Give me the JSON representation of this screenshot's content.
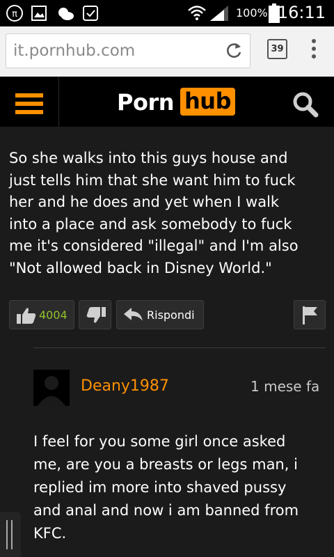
{
  "status_bar": {
    "battery_percent": "100%",
    "time": "16:11",
    "icons": [
      "pi-app-icon",
      "gallery-icon",
      "weather-icon",
      "download-done-icon",
      "wifi-icon",
      "signal-icon",
      "battery-icon"
    ]
  },
  "browser": {
    "url": "it.pornhub.com",
    "tab_count": "39",
    "icons": [
      "reload-icon",
      "overflow-menu-icon"
    ]
  },
  "site_header": {
    "logo_part1": "Porn",
    "logo_part2": "hub",
    "accent": "#ff9000",
    "icons": [
      "hamburger-menu-icon",
      "search-icon"
    ]
  },
  "comment": {
    "lines": [
      "So she walks into this guys house and",
      "just tells him that she want him to fuck",
      "her and he does and yet when I walk",
      "into a place and ask somebody to fuck",
      "me it's considered \"illegal\" and I'm also",
      "\"Not allowed back in Disney World.\""
    ],
    "actions": {
      "like_count": "4004",
      "reply_label": "Rispondi",
      "like_color": "#92c22f"
    }
  },
  "reply": {
    "username": "Deany1987",
    "timestamp": "1 mese fa",
    "lines": [
      "I feel for you some girl once asked",
      "me, are you a breasts or legs man, i",
      "replied im more into shaved pussy",
      "and anal and now i am banned from",
      "KFC."
    ]
  }
}
